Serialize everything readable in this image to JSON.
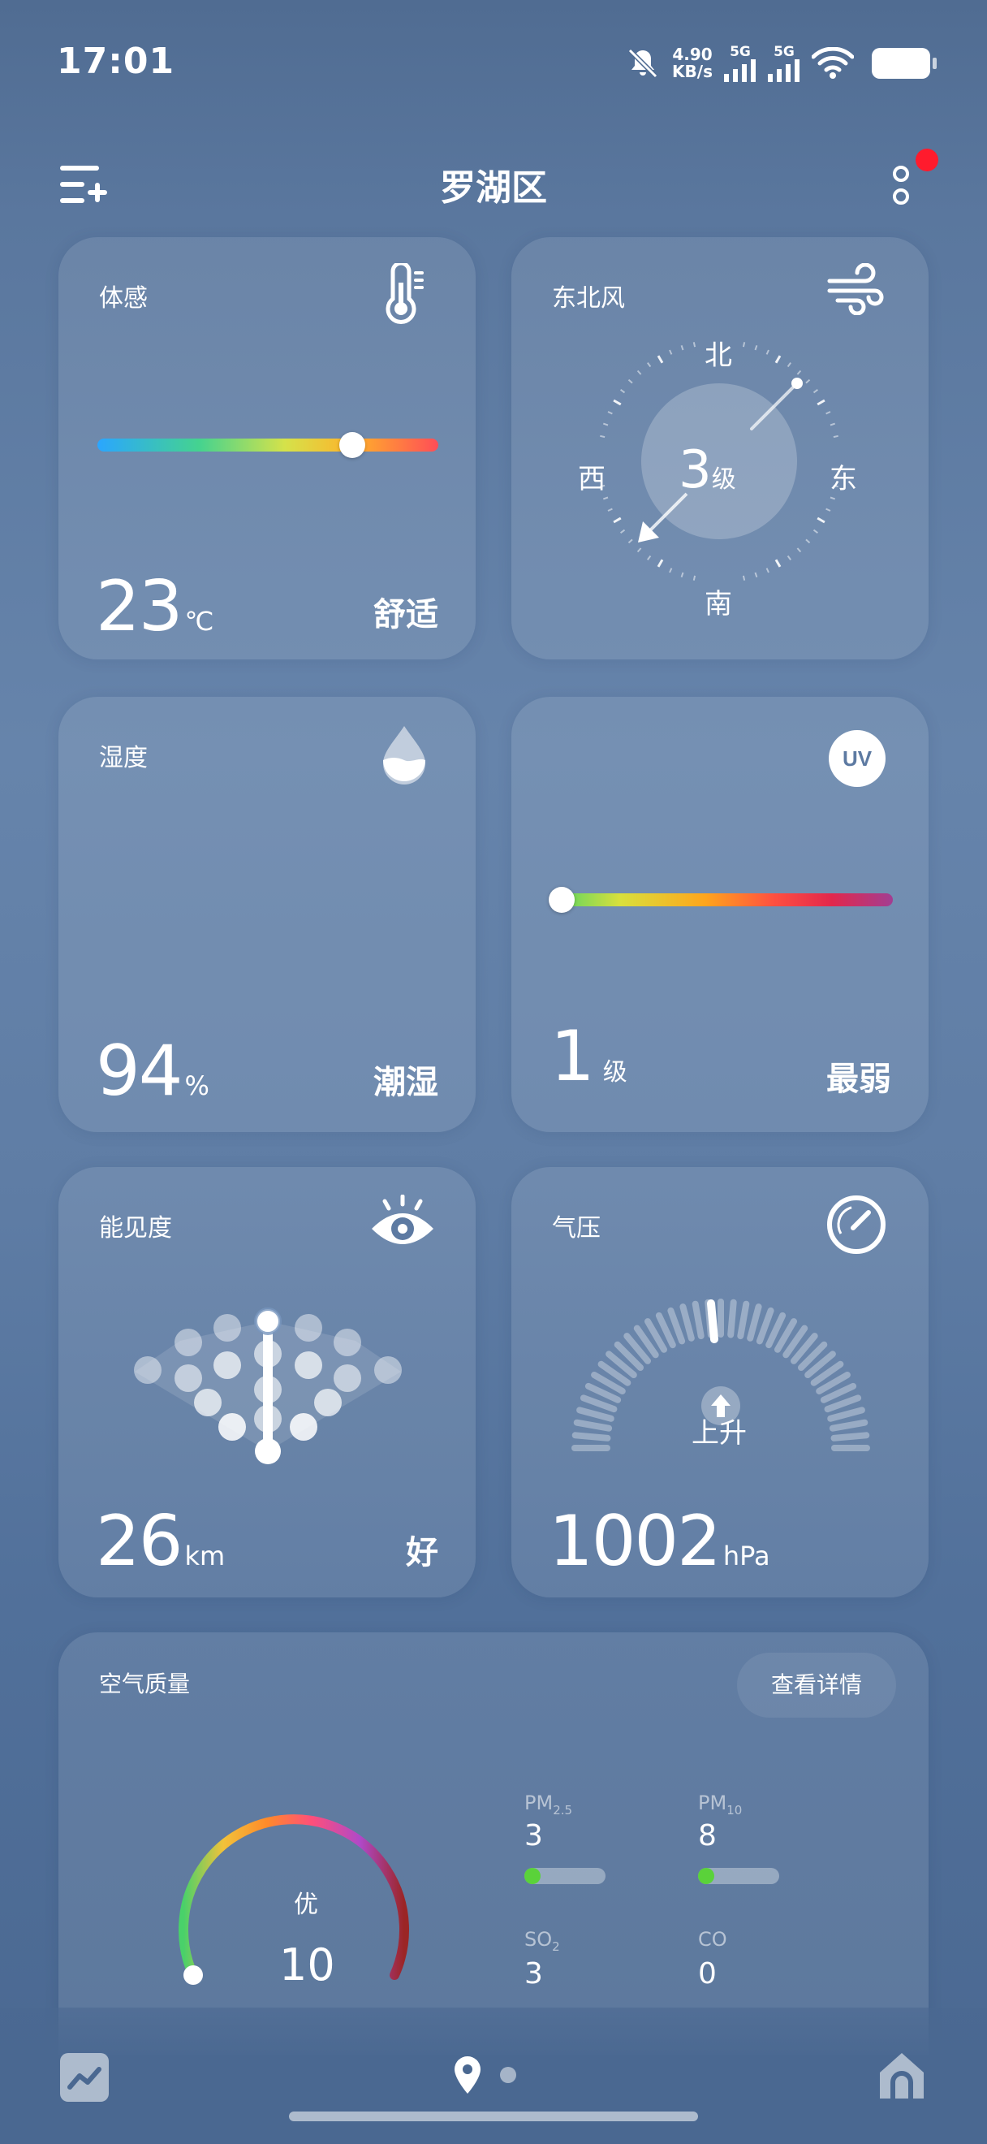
{
  "status_bar": {
    "time": "17:01",
    "net_speed_value": "4.90",
    "net_speed_unit": "KB/s",
    "sim1": "5G",
    "sim2": "5G",
    "battery_level": 1.0
  },
  "header": {
    "title": "罗湖区"
  },
  "feels_like": {
    "label": "体感",
    "value": "23",
    "unit": "℃",
    "description": "舒适",
    "scale_position": 0.75,
    "icon": "thermometer-icon"
  },
  "wind": {
    "label": "东北风",
    "level": "3",
    "level_unit": "级",
    "compass": {
      "north": "北",
      "south": "南",
      "west": "西",
      "east": "东"
    },
    "icon": "wind-icon"
  },
  "humidity": {
    "label": "湿度",
    "value": "94",
    "unit": "%",
    "description": "潮湿",
    "level": 0.94,
    "icon": "water-drop-icon"
  },
  "uv": {
    "icon_text": "UV",
    "value": "1",
    "unit": "级",
    "description": "最弱",
    "scale_position": 0.0
  },
  "visibility": {
    "label": "能见度",
    "value": "26",
    "unit": "km",
    "description": "好",
    "icon": "eye-icon"
  },
  "pressure": {
    "label": "气压",
    "value": "1002",
    "unit": "hPa",
    "trend": "上升",
    "icon": "gauge-icon"
  },
  "air_quality": {
    "label": "空气质量",
    "detail_button": "查看详情",
    "aqi": "10",
    "level": "优",
    "pollutants": [
      {
        "name": "PM",
        "sub": "2.5",
        "value": "3"
      },
      {
        "name": "PM",
        "sub": "10",
        "value": "8"
      },
      {
        "name": "SO",
        "sub": "2",
        "value": "3"
      },
      {
        "name": "CO",
        "sub": "",
        "value": "0"
      }
    ]
  },
  "colors": {
    "accent_red": "#ff1b2d",
    "good_green": "#5ad23a"
  }
}
